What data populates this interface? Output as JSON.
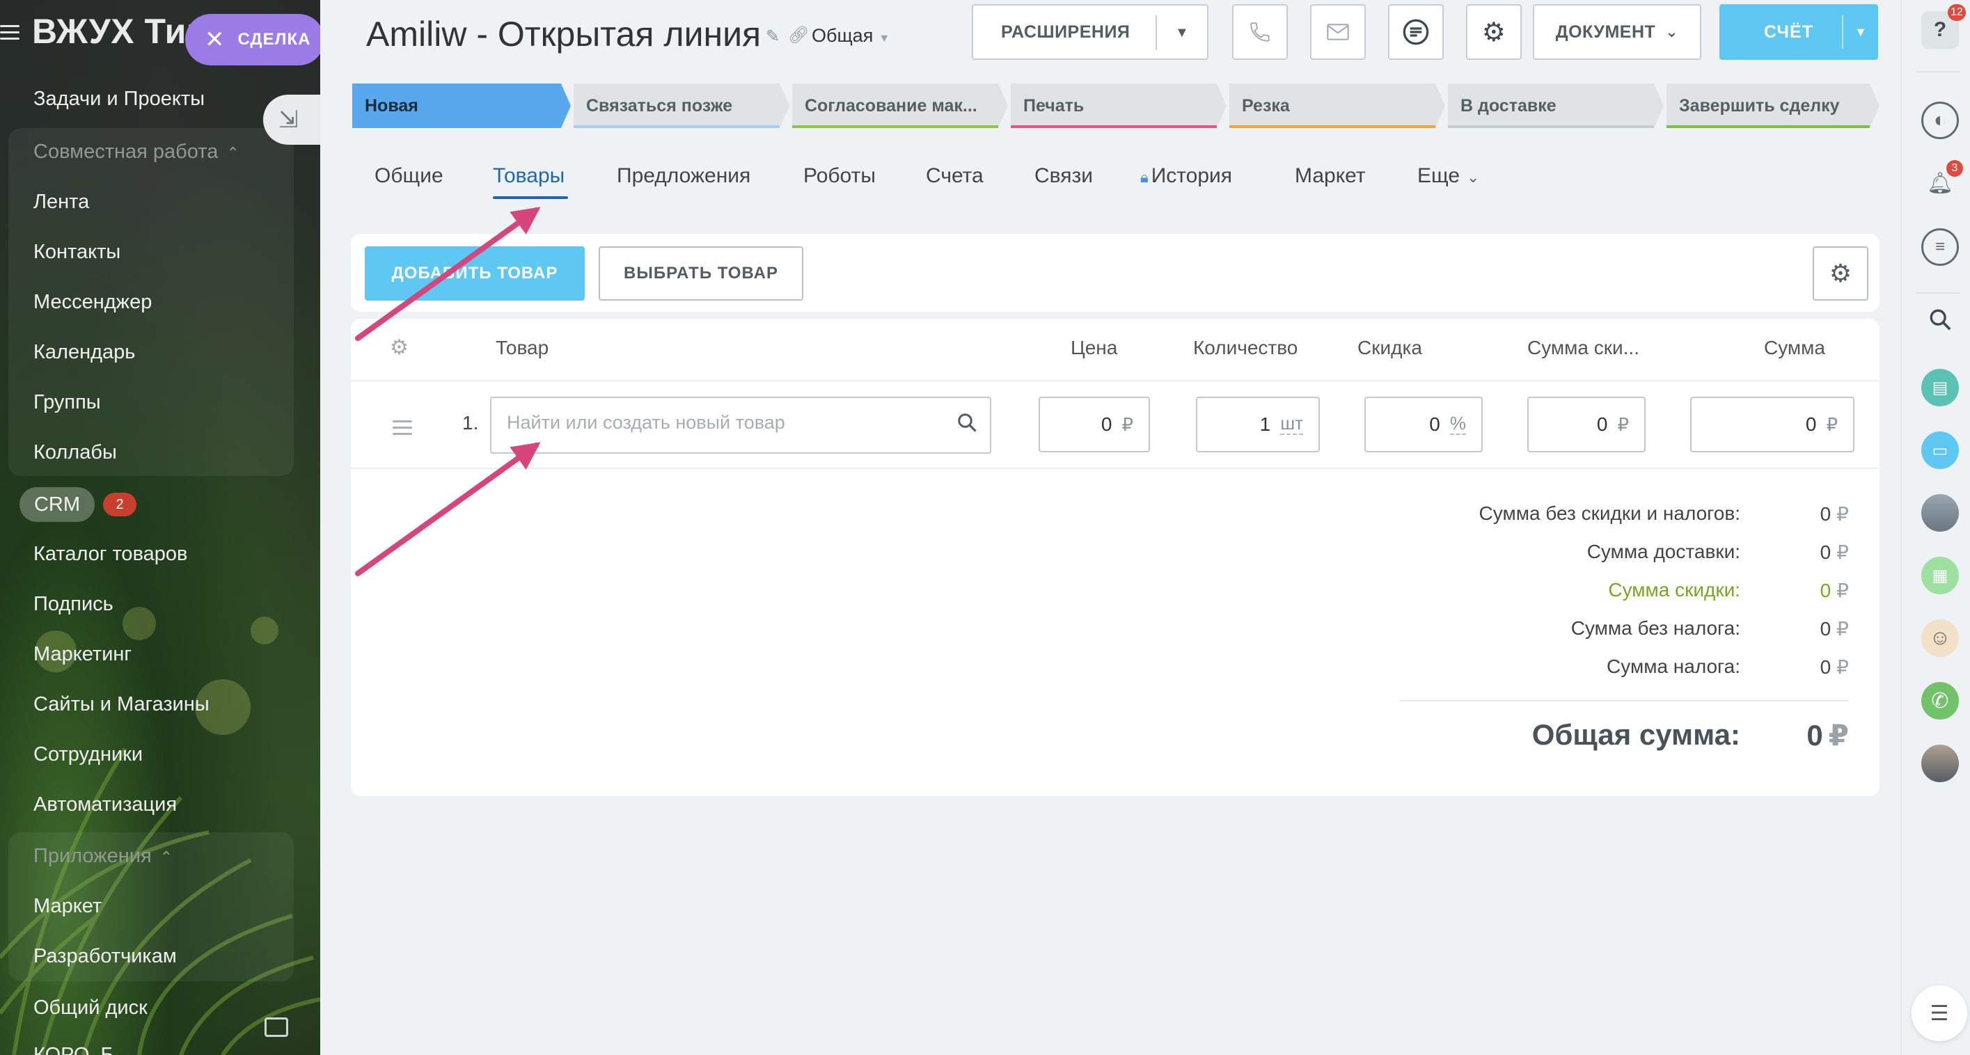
{
  "sidebar": {
    "title": "ВЖУХ Тип",
    "deal_pill": "СДЕЛКА",
    "group1_header": "Совместная работа",
    "items_top": [
      "Задачи и Проекты"
    ],
    "group1_items": [
      "Лента",
      "Контакты",
      "Мессенджер",
      "Календарь",
      "Группы",
      "Коллабы"
    ],
    "crm_label": "CRM",
    "crm_badge": "2",
    "items_mid": [
      "Каталог товаров",
      "Подпись",
      "Маркетинг",
      "Сайты и Магазины",
      "Сотрудники",
      "Автоматизация"
    ],
    "group2_header": "Приложения",
    "group2_items": [
      "Маркет",
      "Разработчикам"
    ],
    "items_bottom": [
      "Общий диск",
      "КОРО..Б"
    ]
  },
  "header": {
    "title": "Amiliw - Открытая линия",
    "category": "Общая",
    "extensions_label": "РАСШИРЕНИЯ",
    "document_label": "ДОКУМЕНТ",
    "invoice_label": "СЧЁТ"
  },
  "stages": [
    {
      "label": "Новая",
      "color": "#59a8ee"
    },
    {
      "label": "Связаться позже",
      "color": "#9fd0f2"
    },
    {
      "label": "Согласование мак...",
      "color": "#8dc63f"
    },
    {
      "label": "Печать",
      "color": "#e8557f"
    },
    {
      "label": "Резка",
      "color": "#f2a33a"
    },
    {
      "label": "В доставке",
      "color": "#c5ccd1"
    },
    {
      "label": "Завершить сделку",
      "color": "#7cc242"
    }
  ],
  "tabs": [
    "Общие",
    "Товары",
    "Предложения",
    "Роботы",
    "Счета",
    "Связи",
    "История",
    "Маркет",
    "Еще"
  ],
  "products": {
    "add_label": "ДОБАВИТЬ ТОВАР",
    "choose_label": "ВЫБРАТЬ ТОВАР",
    "columns": [
      "Товар",
      "Цена",
      "Количество",
      "Скидка",
      "Сумма ски...",
      "Сумма"
    ],
    "row": {
      "number": "1.",
      "search_placeholder": "Найти или создать новый товар",
      "price": "0",
      "currency": "₽",
      "quantity": "1",
      "unit": "шт",
      "discount": "0",
      "discount_unit": "%",
      "discount_sum": "0",
      "sum": "0"
    }
  },
  "totals": [
    {
      "label": "Сумма без скидки и налогов:",
      "value": "0"
    },
    {
      "label": "Сумма доставки:",
      "value": "0"
    },
    {
      "label": "Сумма скидки:",
      "value": "0",
      "highlight": true
    },
    {
      "label": "Сумма без налога:",
      "value": "0"
    },
    {
      "label": "Сумма налога:",
      "value": "0"
    }
  ],
  "grand_total": {
    "label": "Общая сумма:",
    "value": "0"
  },
  "right_panel": {
    "help_badge": "12",
    "bell_badge": "3"
  },
  "colors": {
    "accent": "#5ec8f2",
    "link": "#2067b0",
    "highlight_green": "#7aa524",
    "annotation_arrow": "#d6457b"
  }
}
